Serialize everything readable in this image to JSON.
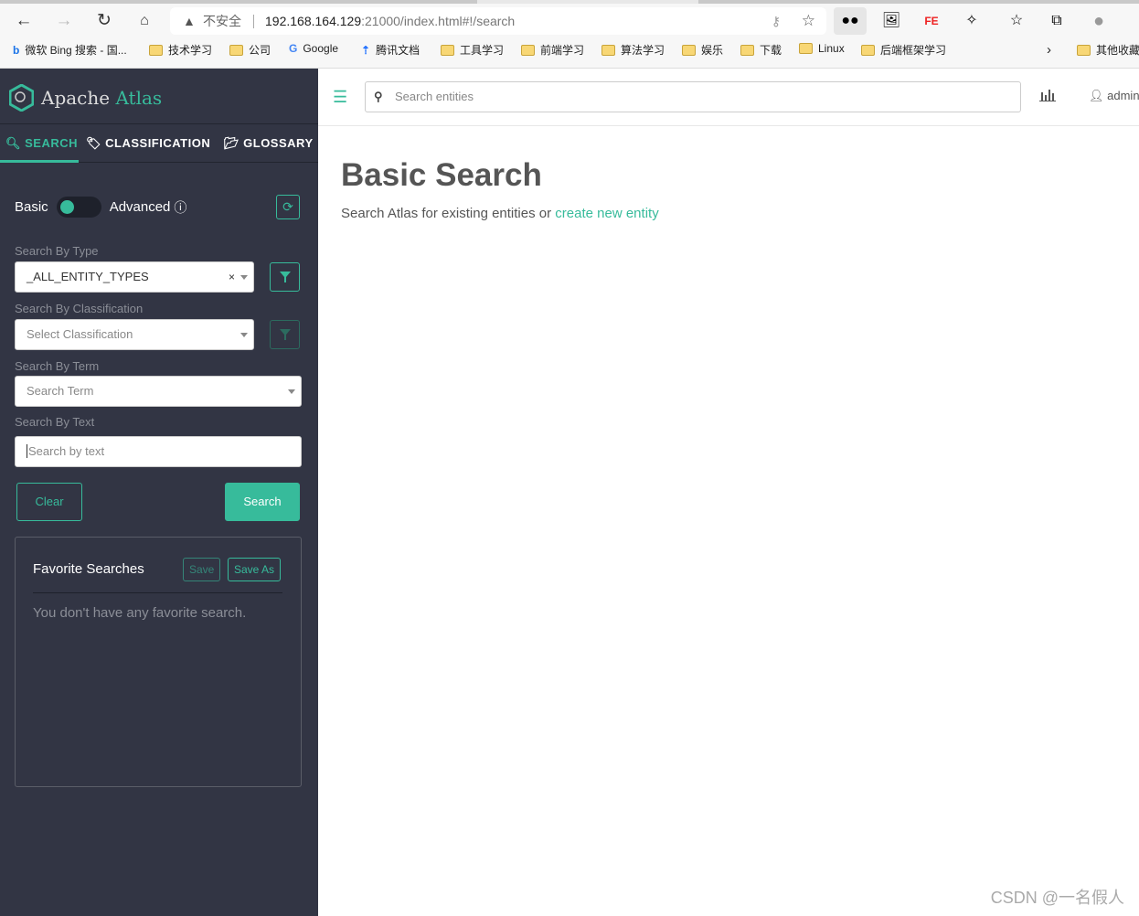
{
  "browser": {
    "insecure_label": "不安全",
    "url_host": "192.168.164.129",
    "url_rest": ":21000/index.html#!/search",
    "bookmarks": [
      "微软 Bing 搜索 - 国...",
      "技术学习",
      "公司",
      "Google",
      "腾讯文档",
      "工具学习",
      "前端学习",
      "算法学习",
      "娱乐",
      "下载",
      "Linux",
      "后端框架学习"
    ],
    "other_bookmarks": "其他收藏"
  },
  "app": {
    "brand_a": "Apache",
    "brand_b": "Atlas",
    "accent": "#37bb9b",
    "sidebar_bg": "#323544"
  },
  "tabs": [
    {
      "label": "SEARCH",
      "icon": "search-icon"
    },
    {
      "label": "CLASSIFICATION",
      "icon": "tags-icon"
    },
    {
      "label": "GLOSSARY",
      "icon": "folder-open-icon"
    }
  ],
  "toggle": {
    "left": "Basic",
    "right": "Advanced"
  },
  "form": {
    "type_label": "Search By Type",
    "type_value": "_ALL_ENTITY_TYPES",
    "class_label": "Search By Classification",
    "class_placeholder": "Select Classification",
    "term_label": "Search By Term",
    "term_placeholder": "Search Term",
    "text_label": "Search By Text",
    "text_placeholder": "Search by text",
    "clear": "Clear",
    "search": "Search"
  },
  "favorites": {
    "title": "Favorite Searches",
    "save": "Save",
    "save_as": "Save As",
    "empty": "You don't have any favorite search."
  },
  "topbar": {
    "search_placeholder": "Search entities",
    "user": "admin"
  },
  "main": {
    "title": "Basic Search",
    "subtitle": "Search Atlas for existing entities or",
    "link": "create new entity"
  },
  "watermark": "CSDN @一名假人"
}
